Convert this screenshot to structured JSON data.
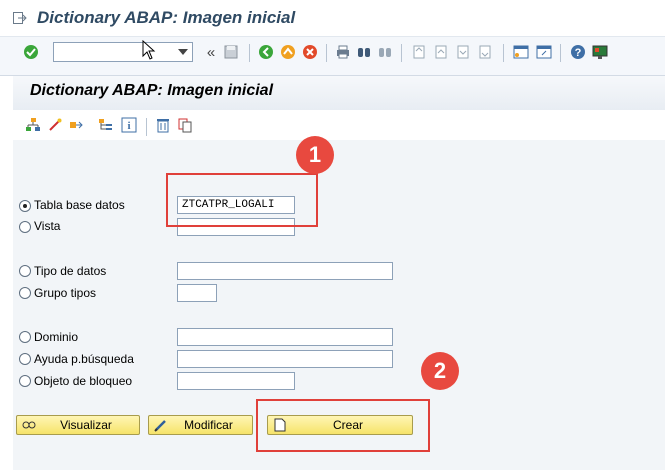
{
  "window": {
    "title": "Dictionary ABAP: Imagen inicial"
  },
  "toolbar": {
    "command_value": ""
  },
  "screen": {
    "header": "Dictionary ABAP: Imagen inicial"
  },
  "objects": [
    {
      "label": "Tabla base datos",
      "value": "ZTCATPR_LOGALI",
      "selected": true
    },
    {
      "label": "Vista",
      "value": "",
      "selected": false
    },
    {
      "label": "Tipo de datos",
      "value": "",
      "selected": false
    },
    {
      "label": "Grupo tipos",
      "value": "",
      "selected": false
    },
    {
      "label": "Dominio",
      "value": "",
      "selected": false
    },
    {
      "label": "Ayuda p.búsqueda",
      "value": "",
      "selected": false
    },
    {
      "label": "Objeto de bloqueo",
      "value": "",
      "selected": false
    }
  ],
  "buttons": {
    "display": "Visualizar",
    "change": "Modificar",
    "create": "Crear"
  },
  "annotations": {
    "step1": "1",
    "step2": "2"
  },
  "colors": {
    "accent_red": "#e0403a",
    "button_yellow": "#f6e36a",
    "title_blue": "#2f4a63"
  },
  "icons": [
    "exit-icon",
    "enter-icon",
    "save-icon",
    "back-icon",
    "exit-program-icon",
    "cancel-icon",
    "print-icon",
    "find-icon",
    "find-next-icon",
    "first-page-icon",
    "prev-page-icon",
    "next-page-icon",
    "last-page-icon",
    "new-session-icon",
    "shortcut-icon",
    "help-icon",
    "customize-icon",
    "hierarchy-icon",
    "edit-icon",
    "where-used-icon",
    "object-list-icon",
    "info-icon",
    "delete-icon",
    "copy-icon",
    "display-icon",
    "pencil-icon",
    "document-icon"
  ]
}
